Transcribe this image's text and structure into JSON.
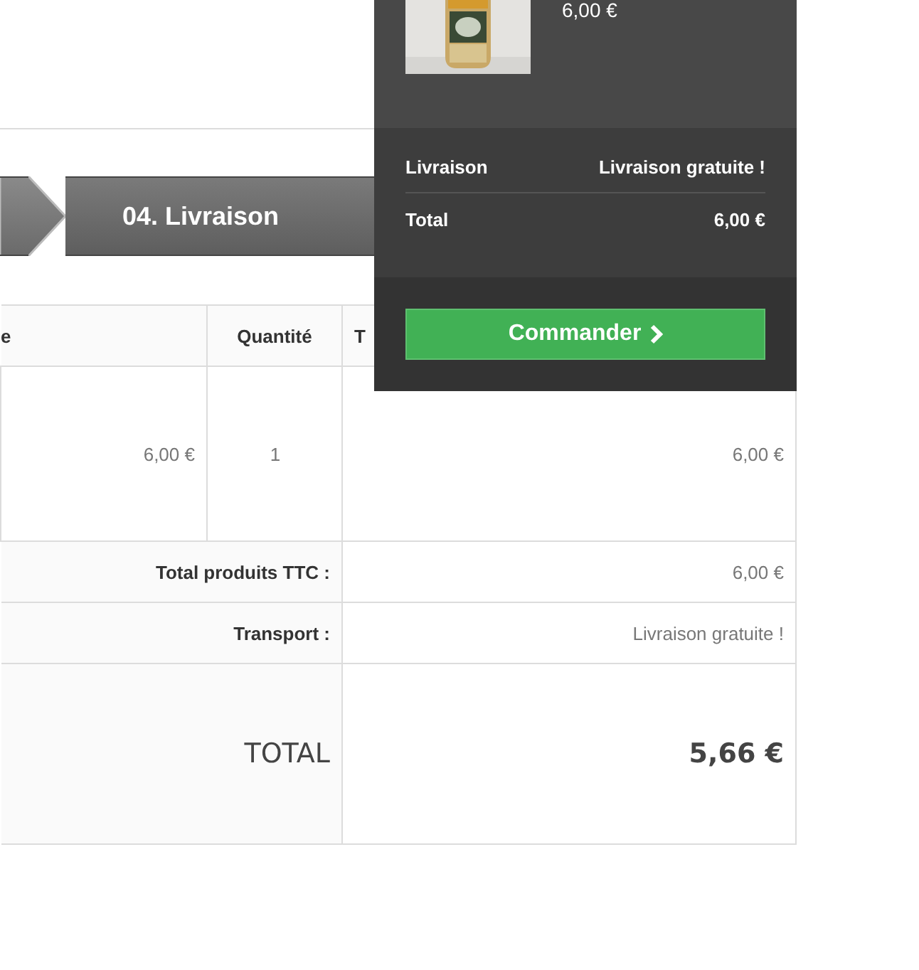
{
  "steps": [
    {
      "label": "04. Livraison"
    }
  ],
  "table": {
    "columns": [
      "e",
      "Quantité",
      "T"
    ],
    "rows": [
      {
        "cells": [
          "6,00 €",
          "1",
          "6,00 €"
        ]
      }
    ],
    "totals": [
      {
        "kind": "normal",
        "label": "Total produits TTC :",
        "value": "6,00 €"
      },
      {
        "kind": "normal",
        "label": "Transport :",
        "value": "Livraison gratuite !"
      },
      {
        "kind": "grand",
        "label": "TOTAL",
        "value": "5,66 €"
      }
    ]
  },
  "cart_dropdown": {
    "product_price": "6,00 €",
    "summary": [
      {
        "label": "Livraison",
        "value": "Livraison gratuite !"
      },
      {
        "label": "Total",
        "value": "6,00 €"
      }
    ],
    "button": "Commander"
  }
}
